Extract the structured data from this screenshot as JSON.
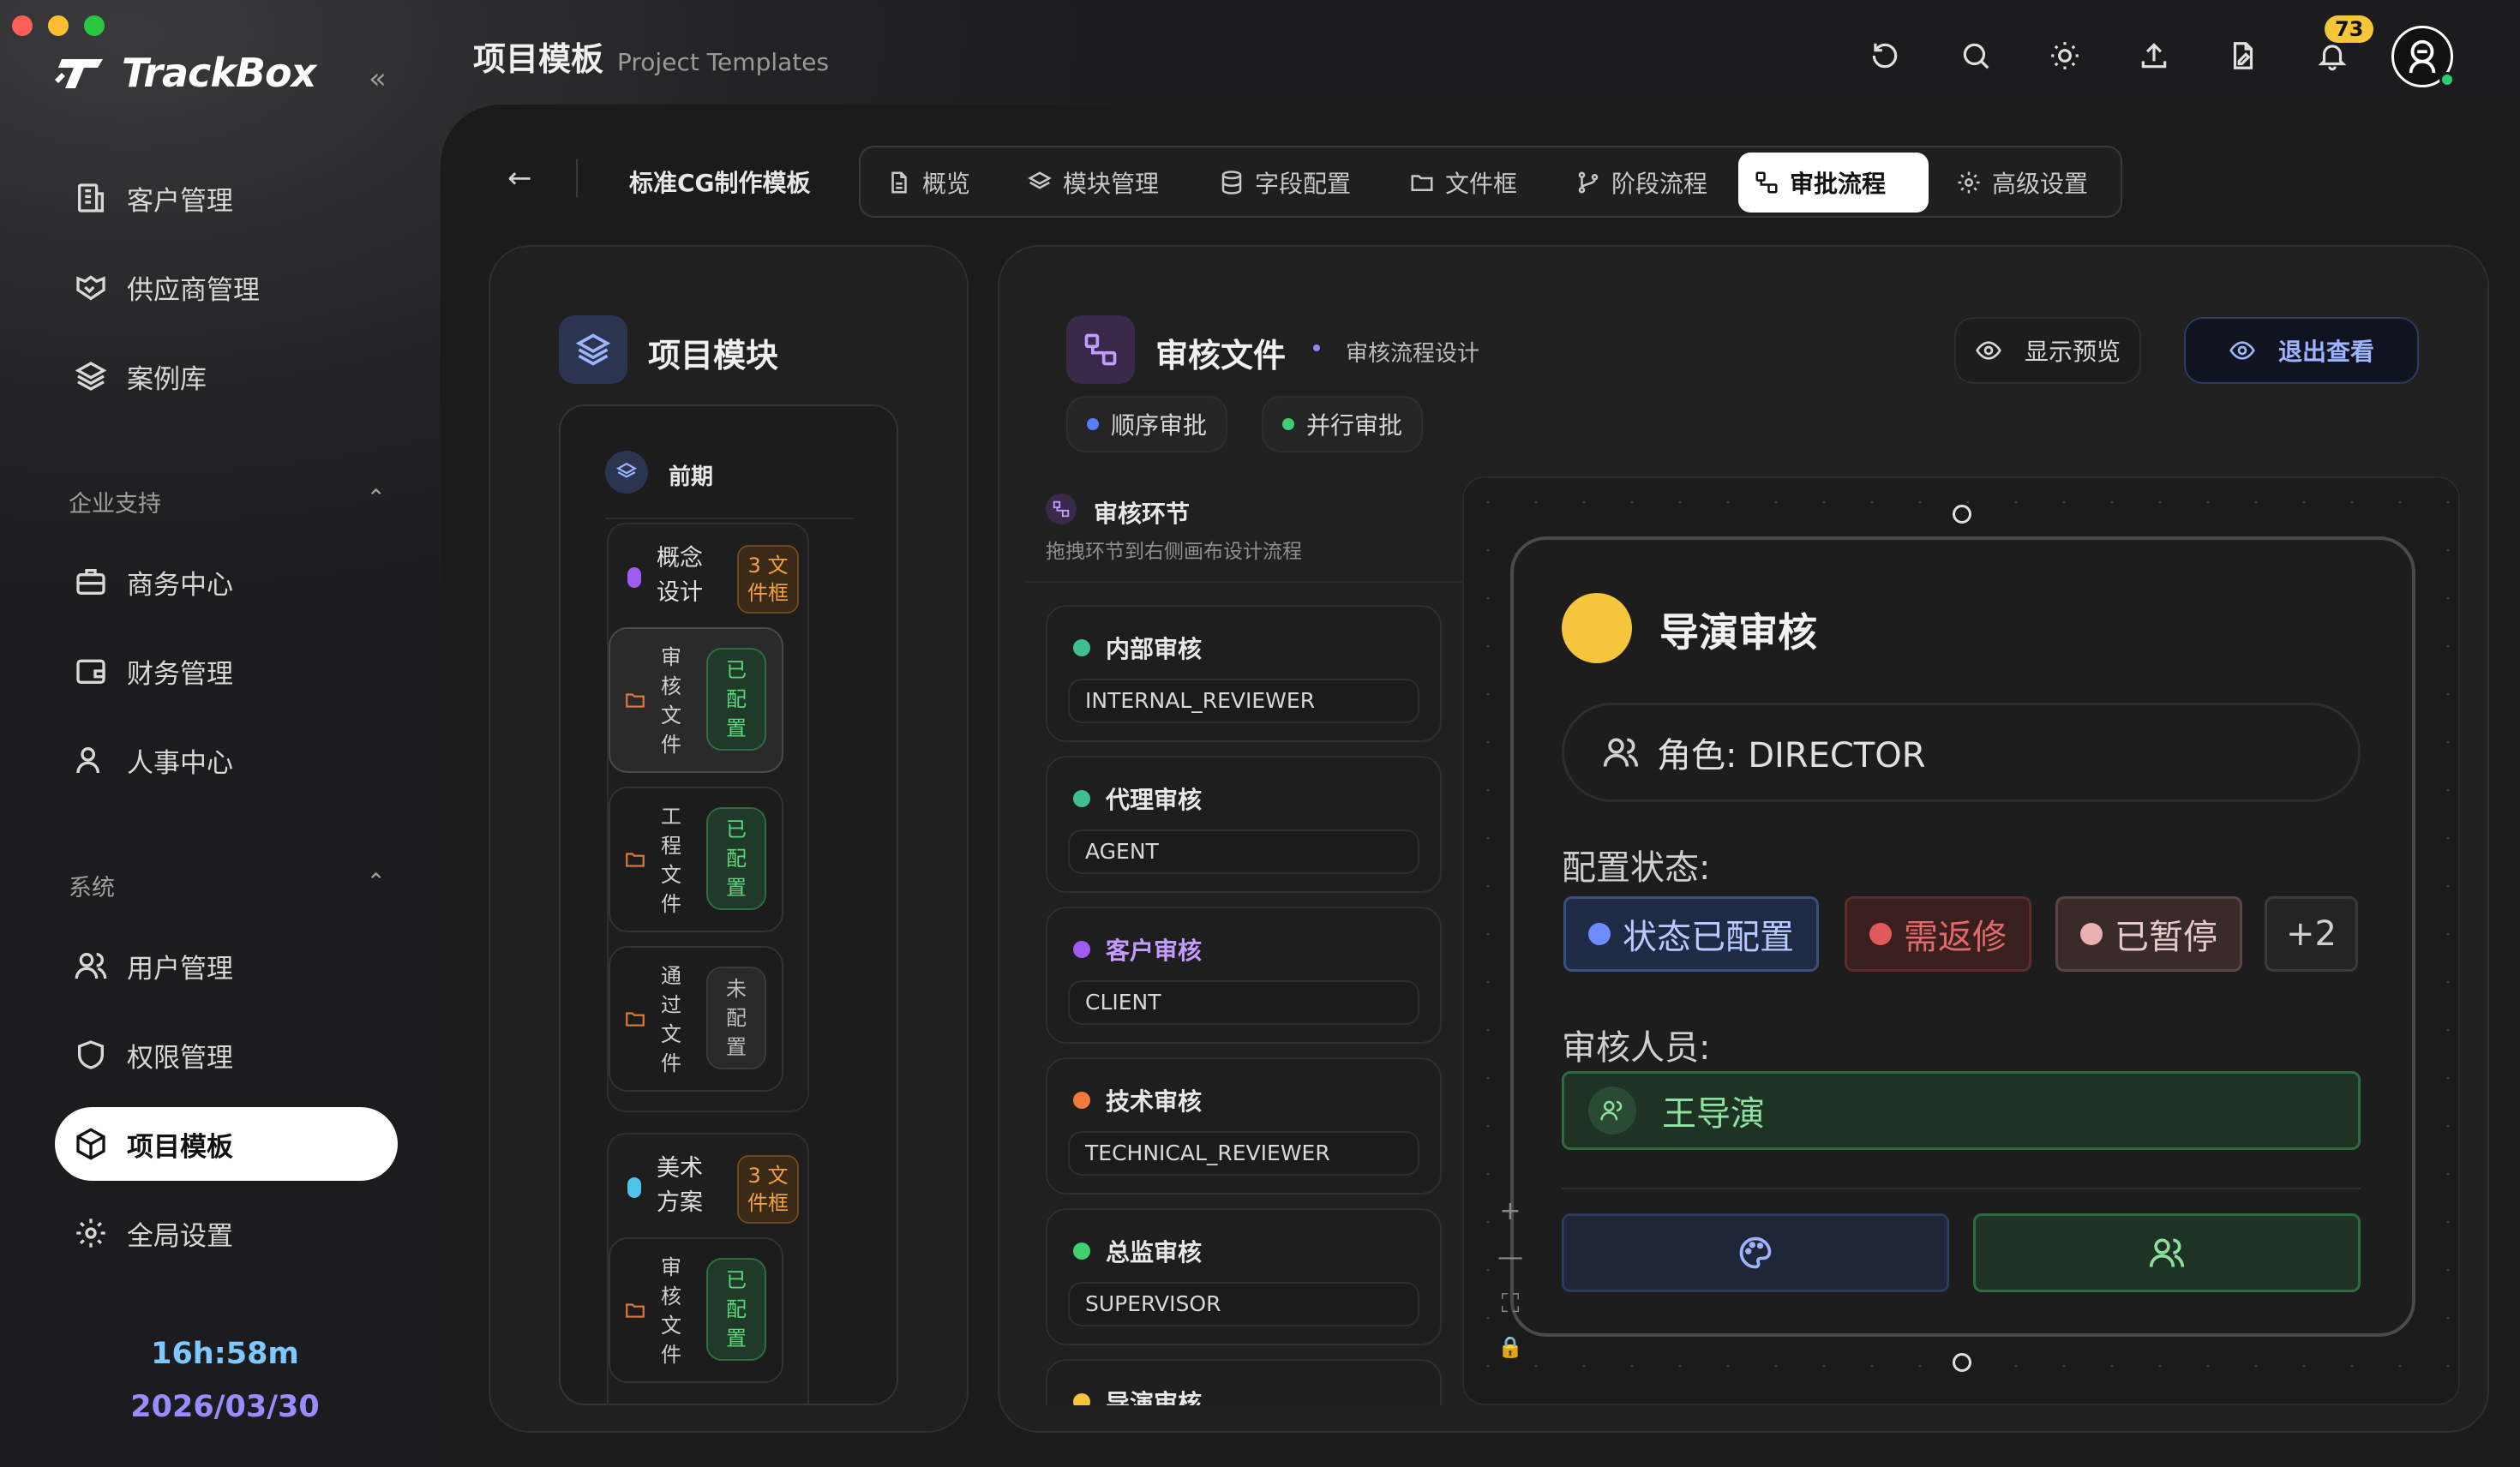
{
  "app": {
    "name": "TrackBox"
  },
  "colors": {
    "accent_blue": "#9fb4ff",
    "active_tab": "#ffffff",
    "timer_cyan": "#7ec8ff",
    "date_purple": "#9a8cff",
    "badge_yellow": "#f5c53b"
  },
  "sidebar": {
    "items_top": [
      {
        "label": "客户管理",
        "icon": "building-icon"
      },
      {
        "label": "供应商管理",
        "icon": "handshake-icon"
      },
      {
        "label": "案例库",
        "icon": "layers-icon"
      }
    ],
    "section_enterprise": {
      "label": "企业支持"
    },
    "items_enterprise": [
      {
        "label": "商务中心",
        "icon": "briefcase-icon"
      },
      {
        "label": "财务管理",
        "icon": "wallet-icon"
      },
      {
        "label": "人事中心",
        "icon": "user-icon"
      }
    ],
    "section_system": {
      "label": "系统"
    },
    "items_system": [
      {
        "label": "用户管理",
        "icon": "users-icon"
      },
      {
        "label": "权限管理",
        "icon": "shield-icon"
      },
      {
        "label": "项目模板",
        "icon": "box-icon",
        "active": true
      },
      {
        "label": "全局设置",
        "icon": "gear-icon"
      }
    ],
    "timer": "16h:58m",
    "date": "2026/03/30"
  },
  "header": {
    "title_zh": "项目模板",
    "title_en": "Project Templates",
    "notification_count": "73"
  },
  "template": {
    "name": "标准CG制作模板"
  },
  "tabs": [
    {
      "label": "概览",
      "icon": "document-icon"
    },
    {
      "label": "模块管理",
      "icon": "layers-icon"
    },
    {
      "label": "字段配置",
      "icon": "database-icon"
    },
    {
      "label": "文件框",
      "icon": "folder-icon"
    },
    {
      "label": "阶段流程",
      "icon": "branch-icon"
    },
    {
      "label": "审批流程",
      "icon": "workflow-icon",
      "active": true
    },
    {
      "label": "高级设置",
      "icon": "gear-icon"
    }
  ],
  "modules": {
    "title": "项目模块",
    "phase": "前期",
    "groups": [
      {
        "name_line1": "概念",
        "name_line2": "设计",
        "count_line1": "3 文",
        "count_line2": "件框",
        "dot_color": "#a05cf0",
        "files": [
          {
            "name": "审核文件",
            "status": "已配置",
            "configured": true,
            "selected": true
          },
          {
            "name": "工程文件",
            "status": "已配置",
            "configured": true
          },
          {
            "name": "通过文件",
            "status": "未配置",
            "configured": false
          }
        ]
      },
      {
        "name_line1": "美术",
        "name_line2": "方案",
        "count_line1": "3 文",
        "count_line2": "件框",
        "dot_color": "#4fc3e8",
        "files": [
          {
            "name": "审核文件",
            "status": "已配置",
            "configured": true
          }
        ]
      }
    ]
  },
  "review": {
    "title": "审核文件",
    "subtitle": "审核流程设计",
    "preview_label": "显示预览",
    "exit_label": "退出查看",
    "sequential_label": "顺序审批",
    "parallel_label": "并行审批",
    "stages_title": "审核环节",
    "stages_hint": "拖拽环节到右侧画布设计流程",
    "stages": [
      {
        "name": "内部审核",
        "code": "INTERNAL_REVIEWER",
        "color": "#3fbf8f"
      },
      {
        "name": "代理审核",
        "code": "AGENT",
        "color": "#3fbf8f"
      },
      {
        "name": "客户审核",
        "code": "CLIENT",
        "color": "#a05cf0"
      },
      {
        "name": "技术审核",
        "code": "TECHNICAL_REVIEWER",
        "color": "#f07a3a"
      },
      {
        "name": "总监审核",
        "code": "SUPERVISOR",
        "color": "#3fcf6f"
      },
      {
        "name": "导演审核",
        "code": "",
        "color": "#f5c53b"
      }
    ]
  },
  "node": {
    "title": "导演审核",
    "role": "角色: DIRECTOR",
    "config_label": "配置状态:",
    "statuses": [
      "状态已配置",
      "需返修",
      "已暂停",
      "+2"
    ],
    "reviewers_label": "审核人员:",
    "reviewer": "王导演"
  },
  "canvas_controls": [
    "+",
    "—",
    "⛶",
    "🔒"
  ]
}
